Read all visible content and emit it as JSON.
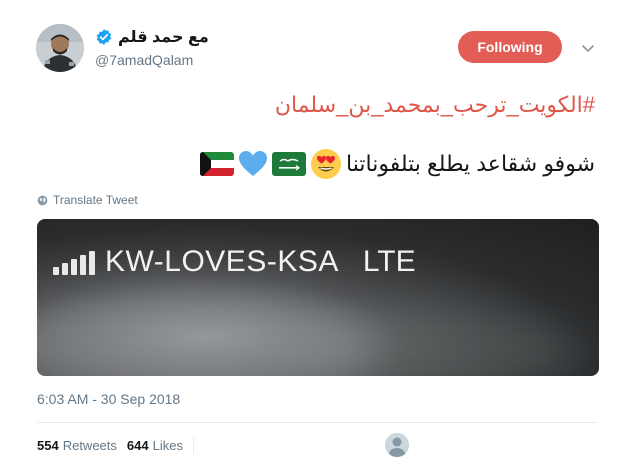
{
  "user": {
    "display_name": "مع حمد قلم",
    "handle": "@7amadQalam",
    "verified_icon": "verified-badge-icon"
  },
  "follow_button": {
    "label": "Following",
    "color": "#e35d57"
  },
  "tweet": {
    "hashtag": "#الكويت_ترحب_بمحمد_بن_سلمان",
    "text": "شوفو شقاعد يطلع بتلفوناتنا",
    "emojis": [
      "heart-eyes-emoji",
      "saudi-flag-emoji",
      "blue-heart-emoji",
      "kuwait-flag-emoji"
    ],
    "translate_label": "Translate Tweet"
  },
  "media": {
    "carrier_text": "KW-LOVES-KSA",
    "network_text": "LTE"
  },
  "timestamp": "6:03 AM - 30 Sep 2018",
  "stats": {
    "retweets_count": "554",
    "retweets_label": "Retweets",
    "likes_count": "644",
    "likes_label": "Likes"
  },
  "colors": {
    "hashtag": "#e25549",
    "muted": "#657786",
    "verified": "#1da1f2"
  }
}
